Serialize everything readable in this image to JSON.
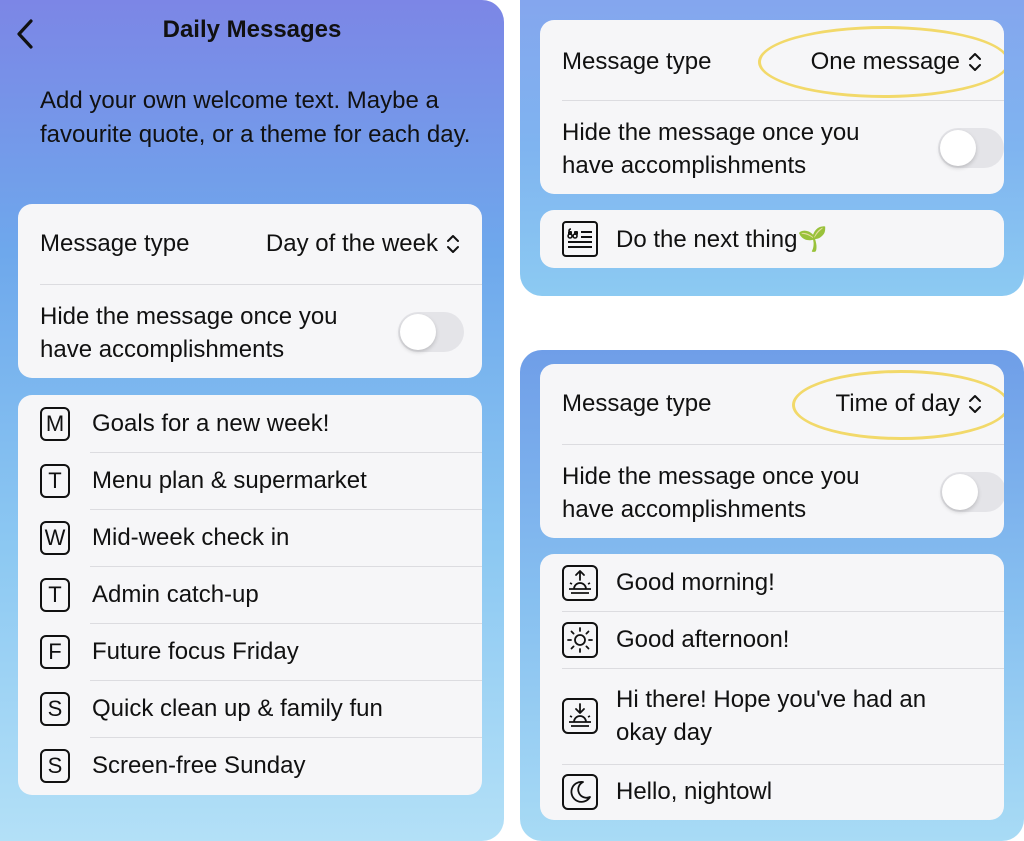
{
  "left": {
    "title": "Daily Messages",
    "intro": "Add your own welcome text. Maybe a favourite quote, or a theme for each day.",
    "message_type_label": "Message type",
    "message_type_value": "Day of the week",
    "hide_line1": "Hide the message once you",
    "hide_line2": "have accomplishments",
    "days": [
      {
        "letter": "M",
        "text": "Goals for a new week!"
      },
      {
        "letter": "T",
        "text": "Menu plan & supermarket"
      },
      {
        "letter": "W",
        "text": "Mid-week check in"
      },
      {
        "letter": "T",
        "text": "Admin catch-up"
      },
      {
        "letter": "F",
        "text": "Future focus Friday"
      },
      {
        "letter": "S",
        "text": "Quick clean up & family fun"
      },
      {
        "letter": "S",
        "text": "Screen-free Sunday"
      }
    ]
  },
  "top_right": {
    "message_type_label": "Message type",
    "message_type_value": "One message",
    "hide_line1": "Hide the message once you",
    "hide_line2": "have accomplishments",
    "message": "Do the next thing🌱",
    "icon": "quote-icon"
  },
  "bottom_right": {
    "message_type_label": "Message type",
    "message_type_value": "Time of day",
    "hide_line1": "Hide the message once you",
    "hide_line2": "have accomplishments",
    "items": [
      {
        "icon": "sunrise-icon",
        "line1": "Good morning!",
        "line2": ""
      },
      {
        "icon": "sun-icon",
        "line1": "Good afternoon!",
        "line2": ""
      },
      {
        "icon": "sunset-icon",
        "line1": "Hi there! Hope you've had an",
        "line2": "okay day"
      },
      {
        "icon": "moon-icon",
        "line1": "Hello, nightowl",
        "line2": ""
      }
    ]
  },
  "colors": {
    "highlight": "#f2d96a",
    "card": "#f6f6f8",
    "toggle_off": "#e4e4e8"
  }
}
